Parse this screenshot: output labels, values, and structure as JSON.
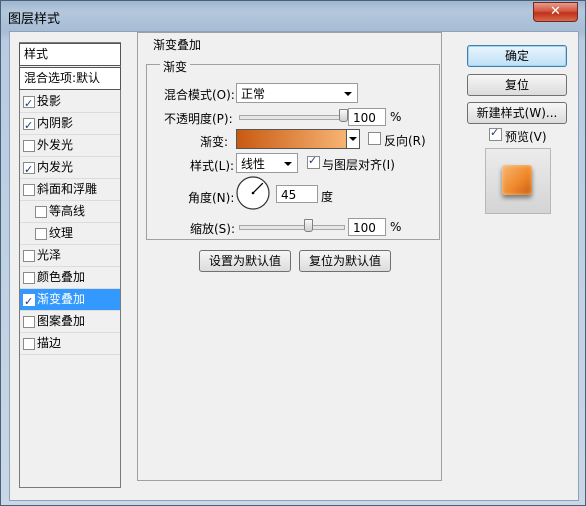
{
  "window": {
    "title": "图层样式",
    "close_glyph": "✕"
  },
  "styles": {
    "header": "样式",
    "blend_default": "混合选项:默认",
    "items": [
      {
        "label": "投影",
        "checked": true,
        "indent": false,
        "selected": false
      },
      {
        "label": "内阴影",
        "checked": true,
        "indent": false,
        "selected": false
      },
      {
        "label": "外发光",
        "checked": false,
        "indent": false,
        "selected": false
      },
      {
        "label": "内发光",
        "checked": true,
        "indent": false,
        "selected": false
      },
      {
        "label": "斜面和浮雕",
        "checked": false,
        "indent": false,
        "selected": false
      },
      {
        "label": "等高线",
        "checked": false,
        "indent": true,
        "selected": false
      },
      {
        "label": "纹理",
        "checked": false,
        "indent": true,
        "selected": false
      },
      {
        "label": "光泽",
        "checked": false,
        "indent": false,
        "selected": false
      },
      {
        "label": "颜色叠加",
        "checked": false,
        "indent": false,
        "selected": false
      },
      {
        "label": "渐变叠加",
        "checked": true,
        "indent": false,
        "selected": true
      },
      {
        "label": "图案叠加",
        "checked": false,
        "indent": false,
        "selected": false
      },
      {
        "label": "描边",
        "checked": false,
        "indent": false,
        "selected": false
      }
    ]
  },
  "panel": {
    "section_title": "渐变叠加",
    "group_title": "渐变",
    "blend_mode_label": "混合模式(O):",
    "blend_mode_value": "正常",
    "opacity_label": "不透明度(P):",
    "opacity_value": "100",
    "opacity_unit": "%",
    "opacity_level": 1.0,
    "gradient_label": "渐变:",
    "reverse_label": "反向(R)",
    "reverse_checked": false,
    "style_label": "样式(L):",
    "style_value": "线性",
    "align_label": "与图层对齐(I)",
    "align_checked": true,
    "angle_label": "角度(N):",
    "angle_value": "45",
    "angle_unit": "度",
    "scale_label": "缩放(S):",
    "scale_value": "100",
    "scale_unit": "%",
    "scale_level": 0.66,
    "make_default_label": "设置为默认值",
    "reset_default_label": "复位为默认值"
  },
  "buttons": {
    "ok": "确定",
    "reset": "复位",
    "new_style": "新建样式(W)...",
    "preview_label": "预览(V)",
    "preview_checked": true
  },
  "colors": {
    "gradient_start": "#c85a12",
    "gradient_end": "#f7b574",
    "preview_swatch": "#f08a2c",
    "selection": "#3399ff"
  }
}
